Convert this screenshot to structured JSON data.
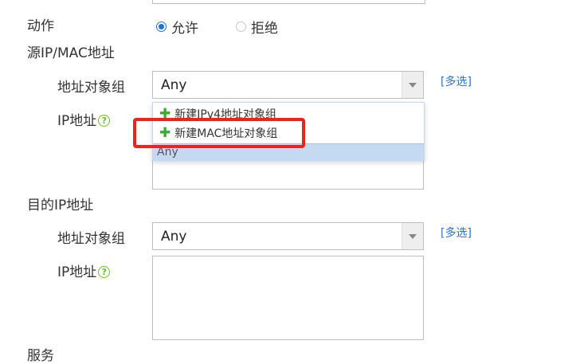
{
  "action": {
    "label": "动作",
    "options": [
      {
        "label": "允许",
        "checked": true
      },
      {
        "label": "拒绝",
        "checked": false
      }
    ]
  },
  "source": {
    "section_label": "源IP/MAC地址",
    "addr_group_label": "地址对象组",
    "addr_group_value": "Any",
    "multi_select_link": "[多选]",
    "ip_label": "IP地址",
    "help_glyph": "?",
    "dropdown": {
      "items": [
        {
          "label": "新建IPv4地址对象组"
        },
        {
          "label": "新建MAC地址对象组"
        }
      ],
      "selected": "Any",
      "plus_glyph": "✚"
    }
  },
  "destination": {
    "section_label": "目的IP地址",
    "addr_group_label": "地址对象组",
    "addr_group_value": "Any",
    "multi_select_link": "[多选]",
    "ip_label": "IP地址",
    "help_glyph": "?"
  },
  "service": {
    "section_label": "服务"
  },
  "colors": {
    "accent": "#1f74d2",
    "link": "#2f73c9",
    "help_icon": "#6bbd2a",
    "plus_icon": "#3ca935",
    "highlight_box": "#f0221e",
    "selected_row": "#c5d9f1"
  }
}
